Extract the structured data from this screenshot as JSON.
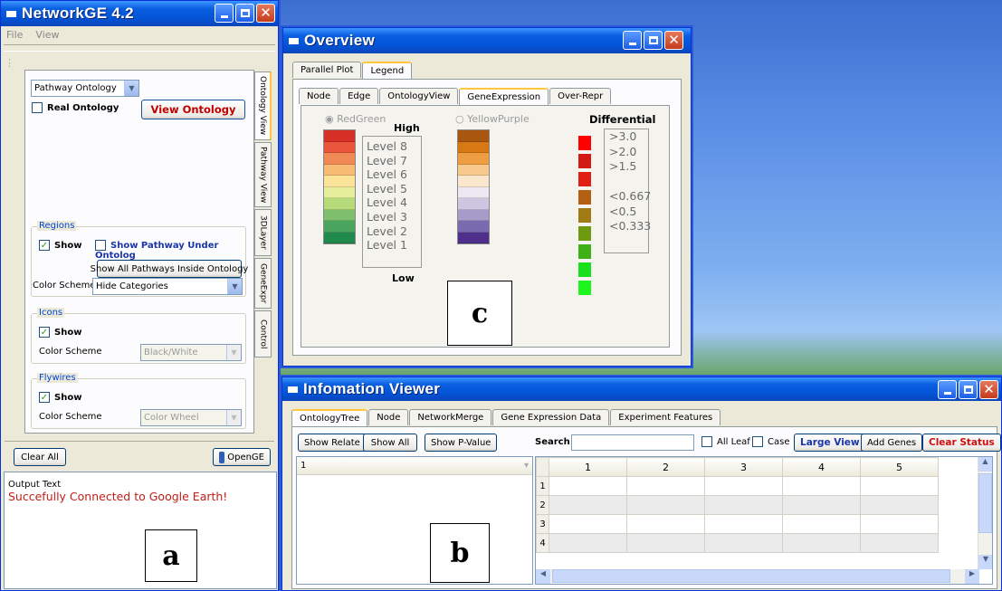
{
  "window_a": {
    "title": "NetworkGE 4.2",
    "menu": [
      "File",
      "View"
    ],
    "ontology_select": "Pathway Ontology",
    "real_ontology": "Real Ontology",
    "view_ontology": "View Ontology",
    "vtabs": [
      "Ontology View",
      "Pathway View",
      "3DLayer",
      "GeneExpr",
      "Control"
    ],
    "regions": {
      "label": "Regions",
      "show": "Show",
      "show_pathway": "Show Pathway Under Ontolog",
      "show_all": "Show All Pathways Inside Ontology",
      "color_label": "Color Scheme",
      "color_value": "Hide Categories"
    },
    "icons": {
      "label": "Icons",
      "show": "Show",
      "color_label": "Color Scheme",
      "color_value": "Black/White"
    },
    "flywires": {
      "label": "Flywires",
      "show": "Show",
      "color_label": "Color Scheme",
      "color_value": "Color Wheel"
    },
    "clear_all": "Clear All",
    "opengl": "OpenGE",
    "output_label": "Output Text",
    "output_msg": "Succefully Connected to Google Earth!"
  },
  "window_c": {
    "title": "Overview",
    "outer_tabs": [
      "Parallel Plot",
      "Legend"
    ],
    "inner_tabs": [
      "Node",
      "Edge",
      "OntologyView",
      "GeneExpression",
      "Over-Repr"
    ],
    "redgreen": "RedGreen",
    "high": "High",
    "low": "Low",
    "yellowpurple": "YellowPurple",
    "differential": "Differential",
    "levels": [
      "Level 8",
      "Level 7",
      "Level 6",
      "Level 5",
      "Level 4",
      "Level 3",
      "Level 2",
      "Level 1"
    ],
    "diff_values": [
      ">3.0",
      ">2.0",
      ">1.5",
      "",
      "<0.667",
      "<0.5",
      "<0.333"
    ],
    "rg_colors": [
      "#d73027",
      "#e8553a",
      "#f08a55",
      "#f7bb73",
      "#fbe39a",
      "#e6ee9c",
      "#b6d97a",
      "#7fc06e",
      "#4aa65e",
      "#1f8a4c"
    ],
    "yp_colors": [
      "#a9560f",
      "#d67814",
      "#ee9e42",
      "#f7c98c",
      "#fbe7cd",
      "#ece9f3",
      "#cdc7e2",
      "#a59cc9",
      "#7a6aaf",
      "#4f2f8c"
    ],
    "diff_colors": [
      "#ff0000",
      "#d31a12",
      "#e01e14",
      "#b35f12",
      "#a07a12",
      "#6e9a10",
      "#3fb015",
      "#18e01c",
      "#1ef51f"
    ]
  },
  "window_b": {
    "title": "Infomation Viewer",
    "tabs": [
      "OntologyTree",
      "Node",
      "NetworkMerge",
      "Gene Expression Data",
      "Experiment Features"
    ],
    "buttons": {
      "show_relate": "Show Relate",
      "show_all": "Show All",
      "show_pvalue": "Show P-Value",
      "large_view": "Large View",
      "add_genes": "Add Genes",
      "clear_status": "Clear Status"
    },
    "search": "Search",
    "all_leaf": "All Leaf",
    "case": "Case",
    "tree_header": "1",
    "columns": [
      "1",
      "2",
      "3",
      "4",
      "5"
    ],
    "rows": [
      "1",
      "2",
      "3",
      "4"
    ]
  },
  "labels": {
    "a": "a",
    "b": "b",
    "c": "c"
  }
}
